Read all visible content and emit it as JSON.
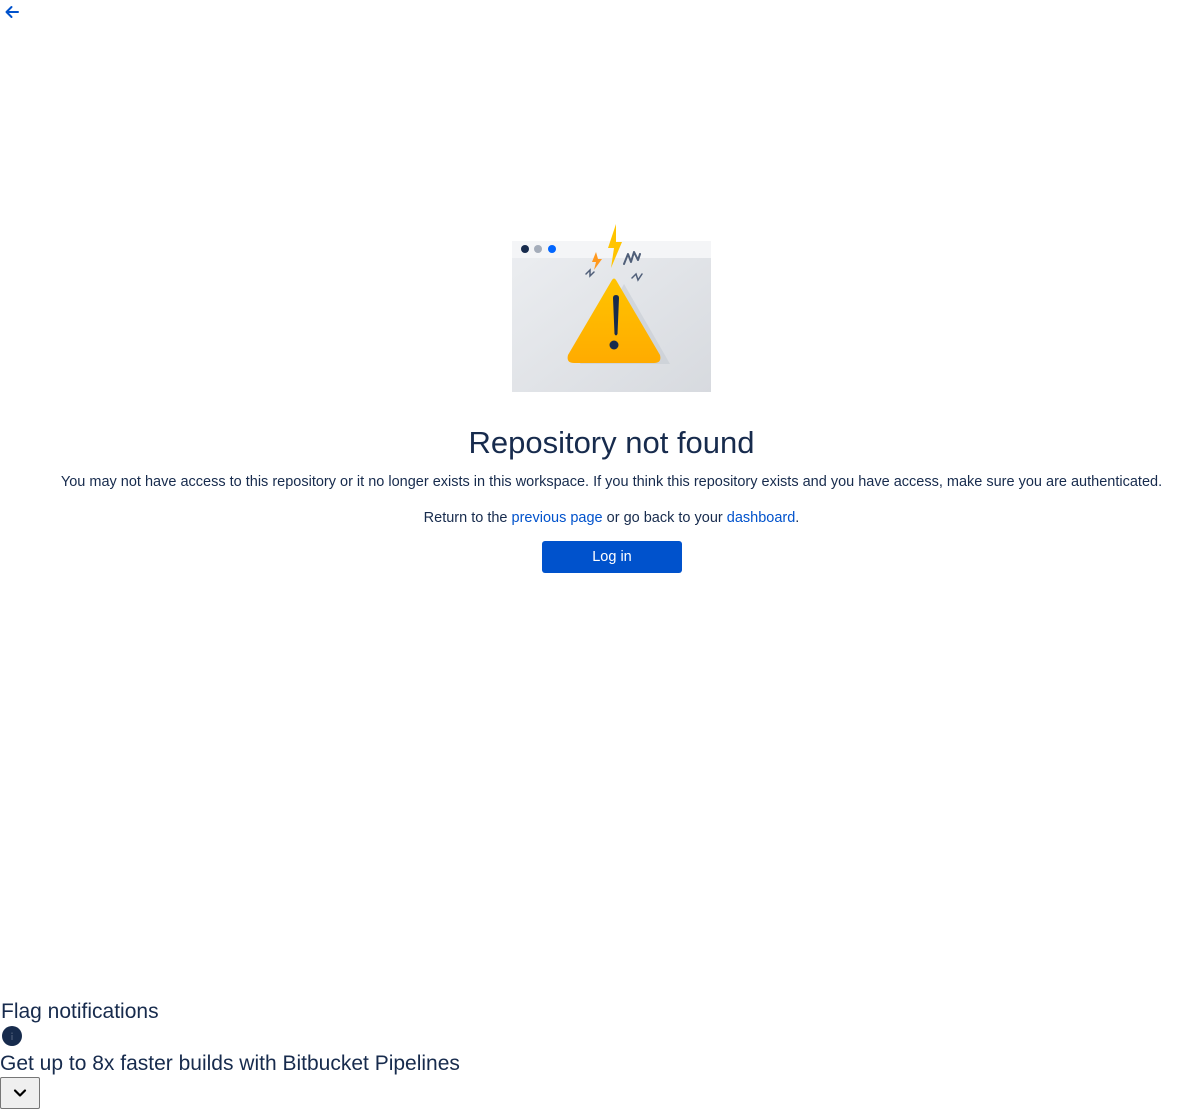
{
  "nav": {
    "back_icon": "arrow-left-icon",
    "back_color": "#0052cc"
  },
  "illustration": {
    "icon": "warning-triangle-illustration"
  },
  "error": {
    "title": "Repository not found",
    "description": "You may not have access to this repository or it no longer exists in this workspace. If you think this repository exists and you have access, make sure you are authenticated.",
    "return_prefix": "Return to the ",
    "previous_page_link": "previous page",
    "return_middle": " or go back to your ",
    "dashboard_link": "dashboard",
    "return_suffix": "."
  },
  "login": {
    "label": "Log in",
    "color": "#0052cc"
  },
  "flags": {
    "heading": "Flag notifications",
    "info_icon": "info-icon",
    "flag_title": "Get up to 8x faster builds with Bitbucket Pipelines",
    "expand_icon": "chevron-down-icon"
  }
}
